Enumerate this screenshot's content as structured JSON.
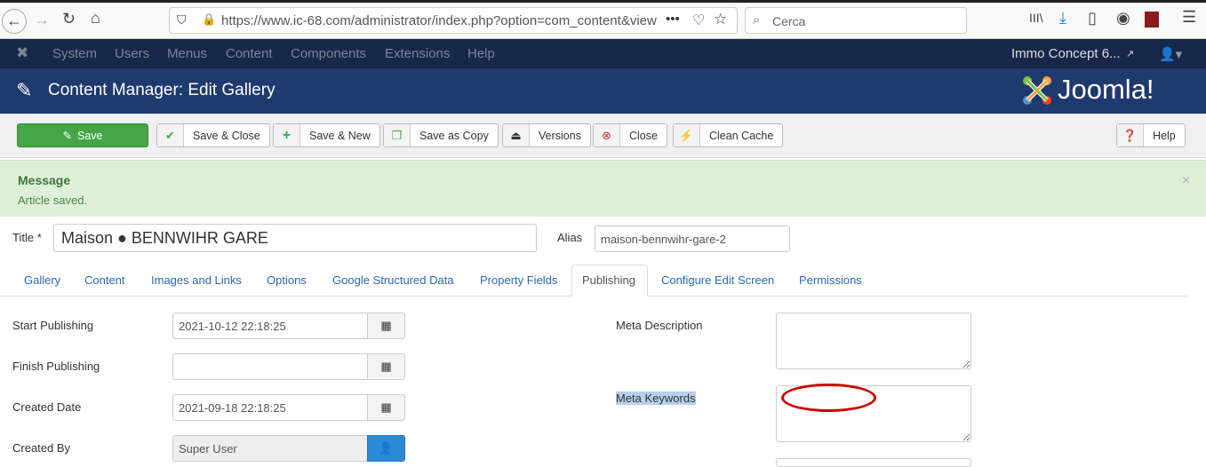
{
  "browser": {
    "url": "https://www.ic-68.com/administrator/index.php?option=com_content&view=a",
    "search_placeholder": "Cerca"
  },
  "nav": {
    "items": [
      "System",
      "Users",
      "Menus",
      "Content",
      "Components",
      "Extensions",
      "Help"
    ],
    "site_link": "Immo Concept 6..."
  },
  "header": {
    "title": "Content Manager: Edit Gallery",
    "logo": "Joomla!"
  },
  "toolbar": {
    "save": "Save",
    "save_close": "Save & Close",
    "save_new": "Save & New",
    "save_copy": "Save as Copy",
    "versions": "Versions",
    "close": "Close",
    "clean_cache": "Clean Cache",
    "help": "Help"
  },
  "message": {
    "heading": "Message",
    "text": "Article saved.",
    "close": "×"
  },
  "form": {
    "title_label": "Title *",
    "title_value": "Maison ● BENNWIHR GARE",
    "alias_label": "Alias",
    "alias_value": "maison-bennwihr-gare-2"
  },
  "tabs": [
    "Gallery",
    "Content",
    "Images and Links",
    "Options",
    "Google Structured Data",
    "Property Fields",
    "Publishing",
    "Configure Edit Screen",
    "Permissions"
  ],
  "publishing": {
    "start_label": "Start Publishing",
    "start_value": "2021-10-12 22:18:25",
    "finish_label": "Finish Publishing",
    "finish_value": "",
    "created_label": "Created Date",
    "created_value": "2021-09-18 22:18:25",
    "created_by_label": "Created By",
    "created_by_value": "Super User",
    "meta_desc_label": "Meta Description",
    "meta_kw_label": "Meta Keywords"
  },
  "colors": {
    "navbar": "#17274a",
    "header": "#1f3a6e",
    "save": "#46a546",
    "message_bg": "#dff0d8",
    "annotation": "#d00000"
  }
}
